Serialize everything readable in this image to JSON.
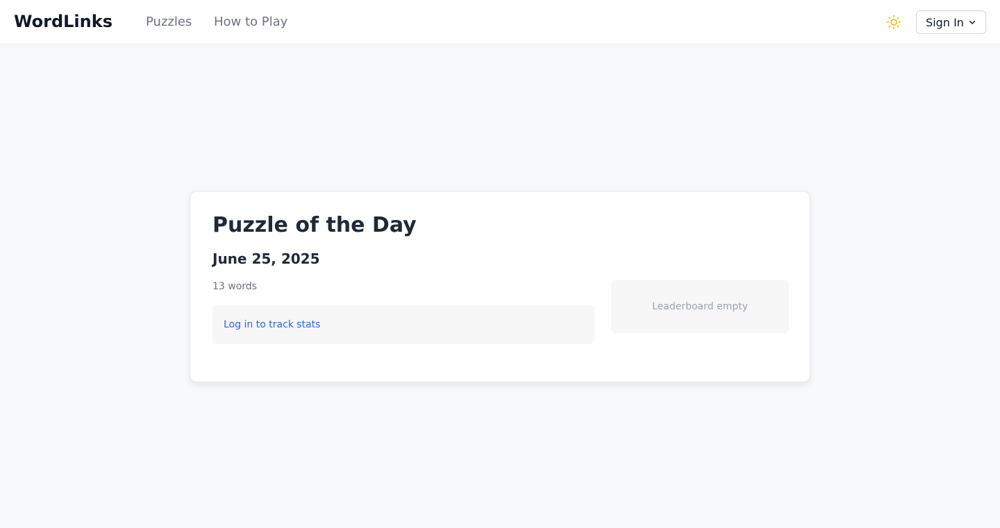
{
  "header": {
    "logo": "WordLinks",
    "nav": [
      {
        "label": "Puzzles"
      },
      {
        "label": "How to Play"
      }
    ],
    "theme_icon": "sun-icon",
    "signin_label": "Sign In"
  },
  "puzzle": {
    "title": "Puzzle of the Day",
    "date": "June 25, 2025",
    "word_count": "13 words",
    "stats_link": "Log in to track stats",
    "leaderboard_text": "Leaderboard empty"
  },
  "colors": {
    "accent_link": "#2563eb",
    "sun": "#f5b800",
    "background": "#f8f9fb"
  }
}
